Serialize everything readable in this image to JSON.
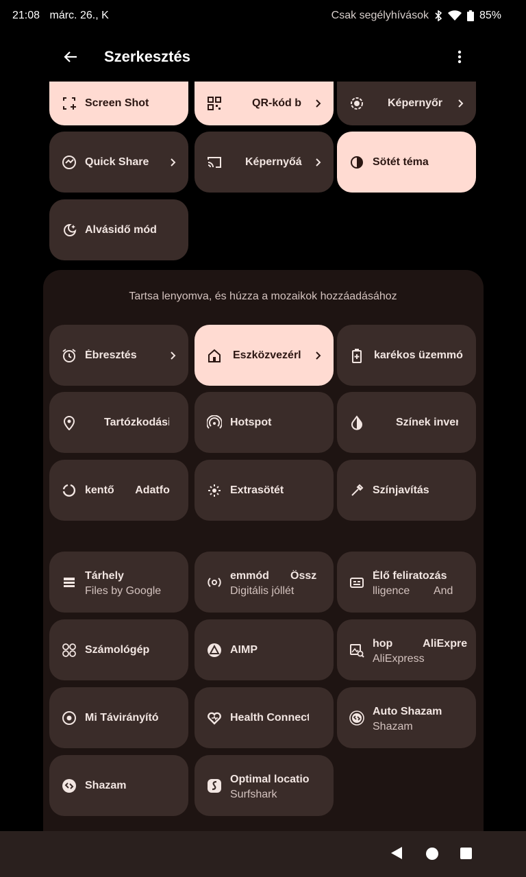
{
  "status_bar": {
    "time": "21:08",
    "date": "márc. 26., K",
    "network_text": "Csak segélyhívások",
    "battery": "85%"
  },
  "app_bar": {
    "title": "Szerkesztés"
  },
  "active_tiles": [
    {
      "label": "Screen Shot",
      "icon": "screenshot-icon",
      "state": "on"
    },
    {
      "label": "QR-kód b",
      "icon": "qr-code-icon",
      "state": "on",
      "chevron": true
    },
    {
      "label": "Képernyőr",
      "icon": "screen-record-icon",
      "state": "off",
      "chevron": true
    },
    {
      "label": "Quick Share",
      "icon": "quick-share-icon",
      "state": "off",
      "chevron": true
    },
    {
      "label": "Képernyőá",
      "icon": "cast-icon",
      "state": "off",
      "chevron": true
    },
    {
      "label": "Sötét téma",
      "icon": "dark-theme-icon",
      "state": "on"
    },
    {
      "label": "Alvásidő mód",
      "icon": "bedtime-icon",
      "state": "off"
    }
  ],
  "hint": "Tartsa lenyomva, és húzza a mozaikok hozzáadásához",
  "available_tiles": [
    {
      "label": "Ébresztés",
      "icon": "alarm-icon",
      "state": "off",
      "chevron": true
    },
    {
      "label": "Eszközvezérl",
      "icon": "home-icon",
      "state": "on",
      "chevron": true
    },
    {
      "label": "karékos üzemmó",
      "icon": "battery-saver-icon",
      "state": "off"
    },
    {
      "label": "Tartózkodási",
      "icon": "location-icon",
      "state": "off"
    },
    {
      "label": "Hotspot",
      "icon": "hotspot-icon",
      "state": "off"
    },
    {
      "label": "Színek invert",
      "icon": "invert-colors-icon",
      "state": "off"
    },
    {
      "label": "kentő       Adatfo",
      "icon": "data-saver-icon",
      "state": "off"
    },
    {
      "label": "Extrasötét",
      "icon": "extra-dim-icon",
      "state": "off"
    },
    {
      "label": "Színjavítás",
      "icon": "color-correction-icon",
      "state": "off"
    }
  ],
  "app_tiles": [
    {
      "label": "Tárhely",
      "sub": "Files by Google",
      "icon": "storage-icon"
    },
    {
      "label": "emmód       Össz",
      "sub": "Digitális jóllét",
      "icon": "focus-mode-icon"
    },
    {
      "label": "Élő feliratozás",
      "sub": "lligence        And",
      "icon": "live-caption-icon"
    },
    {
      "label": "Számológép",
      "sub": "",
      "icon": "calculator-icon"
    },
    {
      "label": "AIMP",
      "sub": "",
      "icon": "aimp-icon"
    },
    {
      "label": "hop          AliExpre",
      "sub": "AliExpress",
      "icon": "aliexpress-icon"
    },
    {
      "label": "Mi Távirányító",
      "sub": "",
      "icon": "remote-icon"
    },
    {
      "label": "Health Connect",
      "sub": "",
      "icon": "health-connect-icon"
    },
    {
      "label": "Auto Shazam",
      "sub": "Shazam",
      "icon": "auto-shazam-icon"
    },
    {
      "label": "Shazam",
      "sub": "",
      "icon": "shazam-icon"
    },
    {
      "label": "Optimal location",
      "sub": "Surfshark",
      "icon": "surfshark-icon"
    }
  ]
}
